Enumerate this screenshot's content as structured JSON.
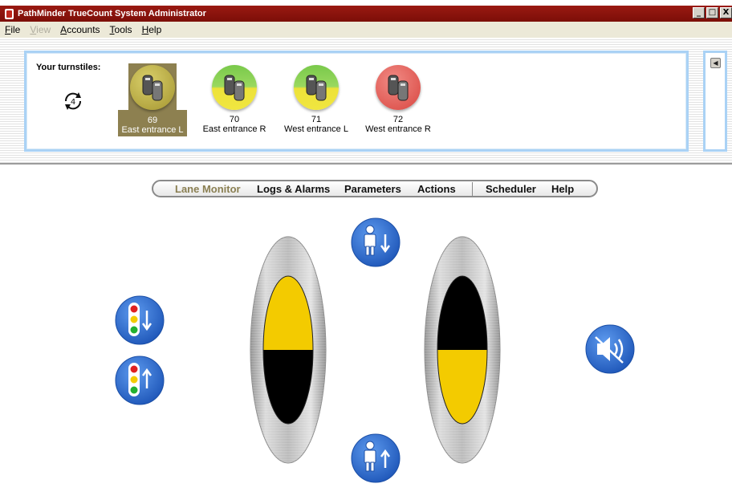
{
  "window": {
    "title": "PathMinder TrueCount System Administrator",
    "controls": [
      "_",
      "□",
      "X"
    ]
  },
  "menu": [
    "File",
    "View",
    "Accounts",
    "Tools",
    "Help"
  ],
  "turnstiles": {
    "label": "Your turnstiles:",
    "refresh_count": "4",
    "items": [
      {
        "id": "69",
        "name": "East entrance L",
        "status": "selected",
        "color": "#b6a83a"
      },
      {
        "id": "70",
        "name": "East entrance R",
        "status": "green-yellow",
        "color": "#8fd05a"
      },
      {
        "id": "71",
        "name": "West entrance L",
        "status": "green-yellow",
        "color": "#8fd05a"
      },
      {
        "id": "72",
        "name": "West entrance R",
        "status": "red",
        "color": "#e05a5a"
      }
    ]
  },
  "nav": {
    "items": [
      "Lane Monitor",
      "Logs & Alarms",
      "Parameters",
      "Actions",
      "Scheduler",
      "Help"
    ],
    "active": "Lane Monitor"
  },
  "lane_monitor": {
    "left_lane": {
      "top_color": "yellow",
      "bottom_color": "black"
    },
    "right_lane": {
      "top_color": "black",
      "bottom_color": "yellow"
    },
    "buttons": [
      "signal-down-icon",
      "signal-up-icon",
      "person-down-icon",
      "person-up-icon",
      "mute-icon"
    ]
  },
  "colors": {
    "title_bar": "#8a140c",
    "panel_border": "#aad2f5",
    "button_blue": "#2f6fd0",
    "yellow": "#f3cb00",
    "active_nav": "#8a7f52"
  }
}
